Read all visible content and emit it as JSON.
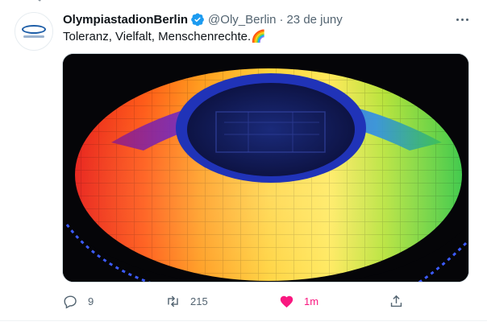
{
  "tweet": {
    "display_name": "OlympiastadionBerlin",
    "handle": "@Oly_Berlin",
    "separator": "·",
    "date": "23 de juny",
    "text": "Toleranz, Vielfalt, Menschenrechte.🌈",
    "verified": true,
    "avatar_icon": "olympiastadion-logo",
    "media_description_icon": "rainbow-stadium-roof-photo"
  },
  "actions": {
    "reply_count": "9",
    "retweet_count": "215",
    "like_count": "1m",
    "liked": true
  },
  "colors": {
    "verified_blue": "#1d9bf0",
    "like_pink": "#f91880",
    "secondary_text": "#536471"
  }
}
